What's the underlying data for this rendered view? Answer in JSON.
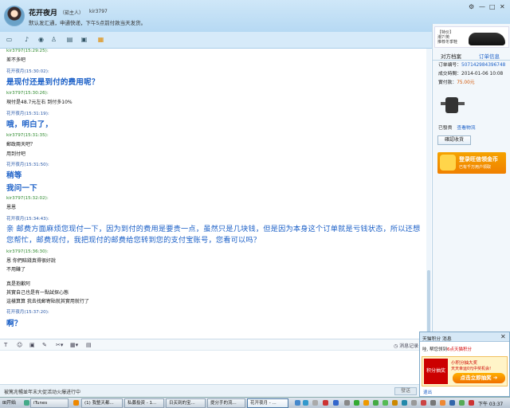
{
  "header": {
    "name": "花开夜月",
    "tag": "（茹主人）",
    "id": "kir3797",
    "status": "默认发汇通，申通快递，下午5点前付款当天发货。"
  },
  "window_controls": [
    "⚙",
    "—",
    "□",
    "✕"
  ],
  "messages": [
    {
      "sender": "kir3797",
      "time": "(15:29:25):",
      "color": "green",
      "text": "差不多吧",
      "size": "small"
    },
    {
      "sender": "花开夜月",
      "time": "(15:30:02):",
      "color": "blue",
      "text": "是现付还是到付的费用呢？",
      "size": "big"
    },
    {
      "sender": "kir3797",
      "time": "(15:30:26):",
      "color": "green",
      "text": "現付是48.7元左右 到付多10%",
      "size": "small"
    },
    {
      "sender": "花开夜月",
      "time": "(15:31:19):",
      "color": "blue",
      "text": "哦，明白了，",
      "size": "big"
    },
    {
      "sender": "kir3797",
      "time": "(15:31:35):",
      "color": "green",
      "text": "郵政兩天吧？",
      "size": "small",
      "extra": "用到付吧"
    },
    {
      "sender": "花开夜月",
      "time": "(15:31:50):",
      "color": "blue",
      "text": "稍等",
      "size": "big",
      "extra": "我问一下"
    },
    {
      "sender": "kir3797",
      "time": "(15:32:02):",
      "color": "green",
      "text": "恩恩",
      "size": "small"
    },
    {
      "sender": "花开夜月",
      "time": "(15:34:43):",
      "color": "blue",
      "text": "亲 邮费方面麻烦您现付一下，因为到付的费用是要贵一点，虽然只是几块钱，但是因为本身这个订单就是亏钱状态，所以还想您帮忙，邮费现付，我把现付的邮费给您转到您的支付宝账号，您看可以吗？",
      "size": "big"
    },
    {
      "sender": "kir3797",
      "time": "(15:36:30):",
      "color": "green",
      "text": "恩 你們賠錢真得很好說",
      "size": "small",
      "extra": "不用賺了",
      "extra2": "真是抱歉阿",
      "extra3": "其實自己也是有一點試探心態",
      "extra4": "這樣算算 我去找郵寄貼就其實用就行了"
    },
    {
      "sender": "花开夜月",
      "time": "(15:37:20):",
      "color": "blue",
      "text": "啊？",
      "size": "big"
    }
  ],
  "input_toolbar": {
    "msg_log": "消息记录"
  },
  "footer": {
    "text": "被篤兆暢並年末大促活动火爆进行中",
    "send": "發送"
  },
  "right_panel": {
    "ad_top": "【特价】\n潮7!英\n推荐冬季鞋",
    "tabs": [
      "对方档案",
      "订单信息"
    ],
    "order_no_label": "订单编号：",
    "order_no": "507142984396748",
    "deal_time_label": "成交時間：",
    "deal_time": "2014-01-06 10:08",
    "paid_label": "實付款：",
    "paid": "75.00元",
    "ship_label": "已發貨",
    "ship_link": "查看物流",
    "confirm": "確認收貨",
    "ad2_title": "登录旺信领金币",
    "ad2_sub": "已有千万用户领取"
  },
  "popup": {
    "title": "天猫积分 消息",
    "line_prefix": "哇, 帮您领到",
    "line_hl": "6点天猫积分",
    "banner_left": "积分抽奖",
    "banner_t1": "小积分抽大奖",
    "banner_t2": "天天幸运0元中奖机会!",
    "banner_btn": "点击立即抽奖 ➔",
    "exit": "退出"
  },
  "taskbar": {
    "start": "开始",
    "tasks": [
      "iTunes",
      "(1) 我整天都...",
      "私募投资 - 1...",
      "日买到的宝...",
      "提分手的流...",
      "花开夜月 - ..."
    ],
    "clock": "下午 03:37"
  }
}
